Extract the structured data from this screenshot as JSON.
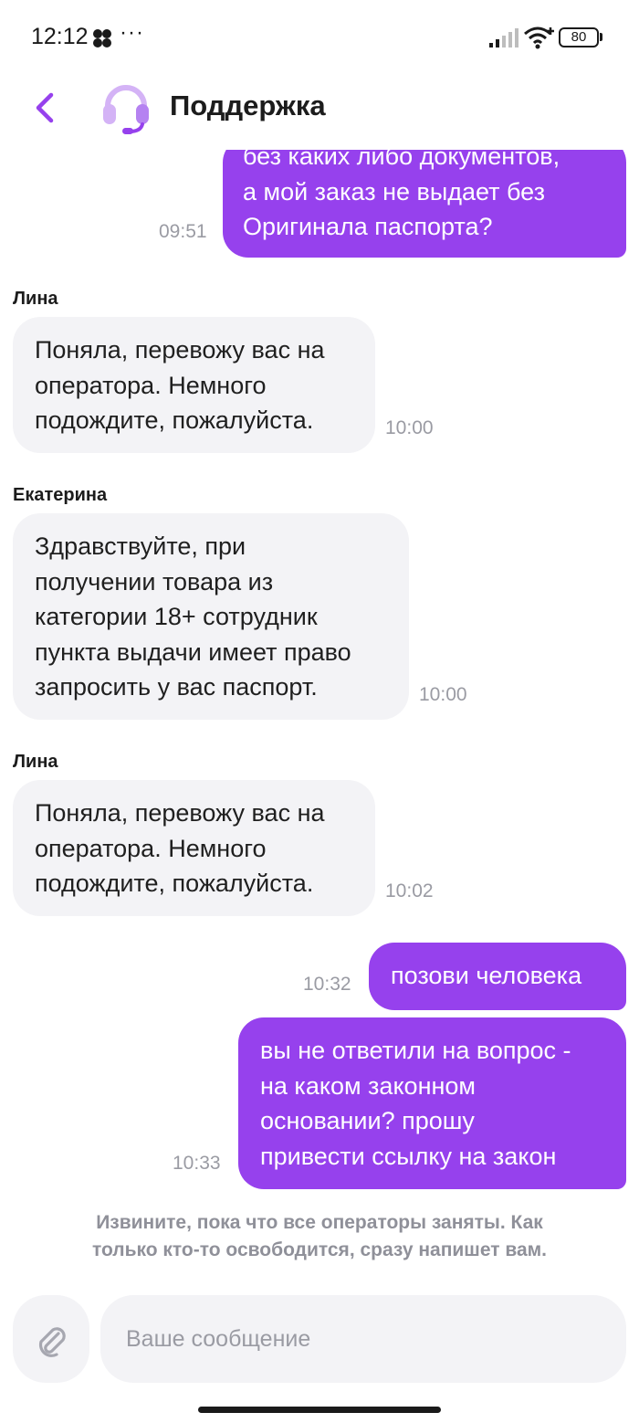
{
  "status_bar": {
    "time": "12:12",
    "more": "···",
    "battery": "80"
  },
  "header": {
    "title": "Поддержка"
  },
  "messages": [
    {
      "time": "09:51",
      "lines": [
        "без каких либо документов,",
        "а мой заказ не выдает без",
        "Оригинала паспорта?"
      ]
    },
    {
      "sender": "Лина",
      "time": "10:00",
      "lines": [
        "Поняла, перевожу вас на",
        "оператора. Немного",
        "подождите, пожалуйста."
      ]
    },
    {
      "sender": "Екатерина",
      "time": "10:00",
      "lines": [
        "Здравствуйте, при",
        "получении товара из",
        "категории 18+ сотрудник",
        "пункта выдачи имеет право",
        "запросить у вас паспорт."
      ]
    },
    {
      "sender": "Лина",
      "time": "10:02",
      "lines": [
        "Поняла, перевожу вас на",
        "оператора. Немного",
        "подождите, пожалуйста."
      ]
    },
    {
      "time": "10:32",
      "lines": [
        "позови человека"
      ]
    },
    {
      "time": "10:33",
      "lines": [
        "вы не ответили на вопрос -",
        "на каком законном",
        "основании? прошу",
        "привести ссылку на закон"
      ]
    }
  ],
  "system_note": {
    "lines": [
      "Извините, пока что все операторы заняты. Как",
      "только кто-то освободится, сразу напишет вам."
    ]
  },
  "composer": {
    "placeholder": "Ваше сообщение"
  },
  "colors": {
    "accent": "#9641ed",
    "incoming_bubble": "#f3f3f6",
    "muted_text": "#9a9ba3"
  }
}
